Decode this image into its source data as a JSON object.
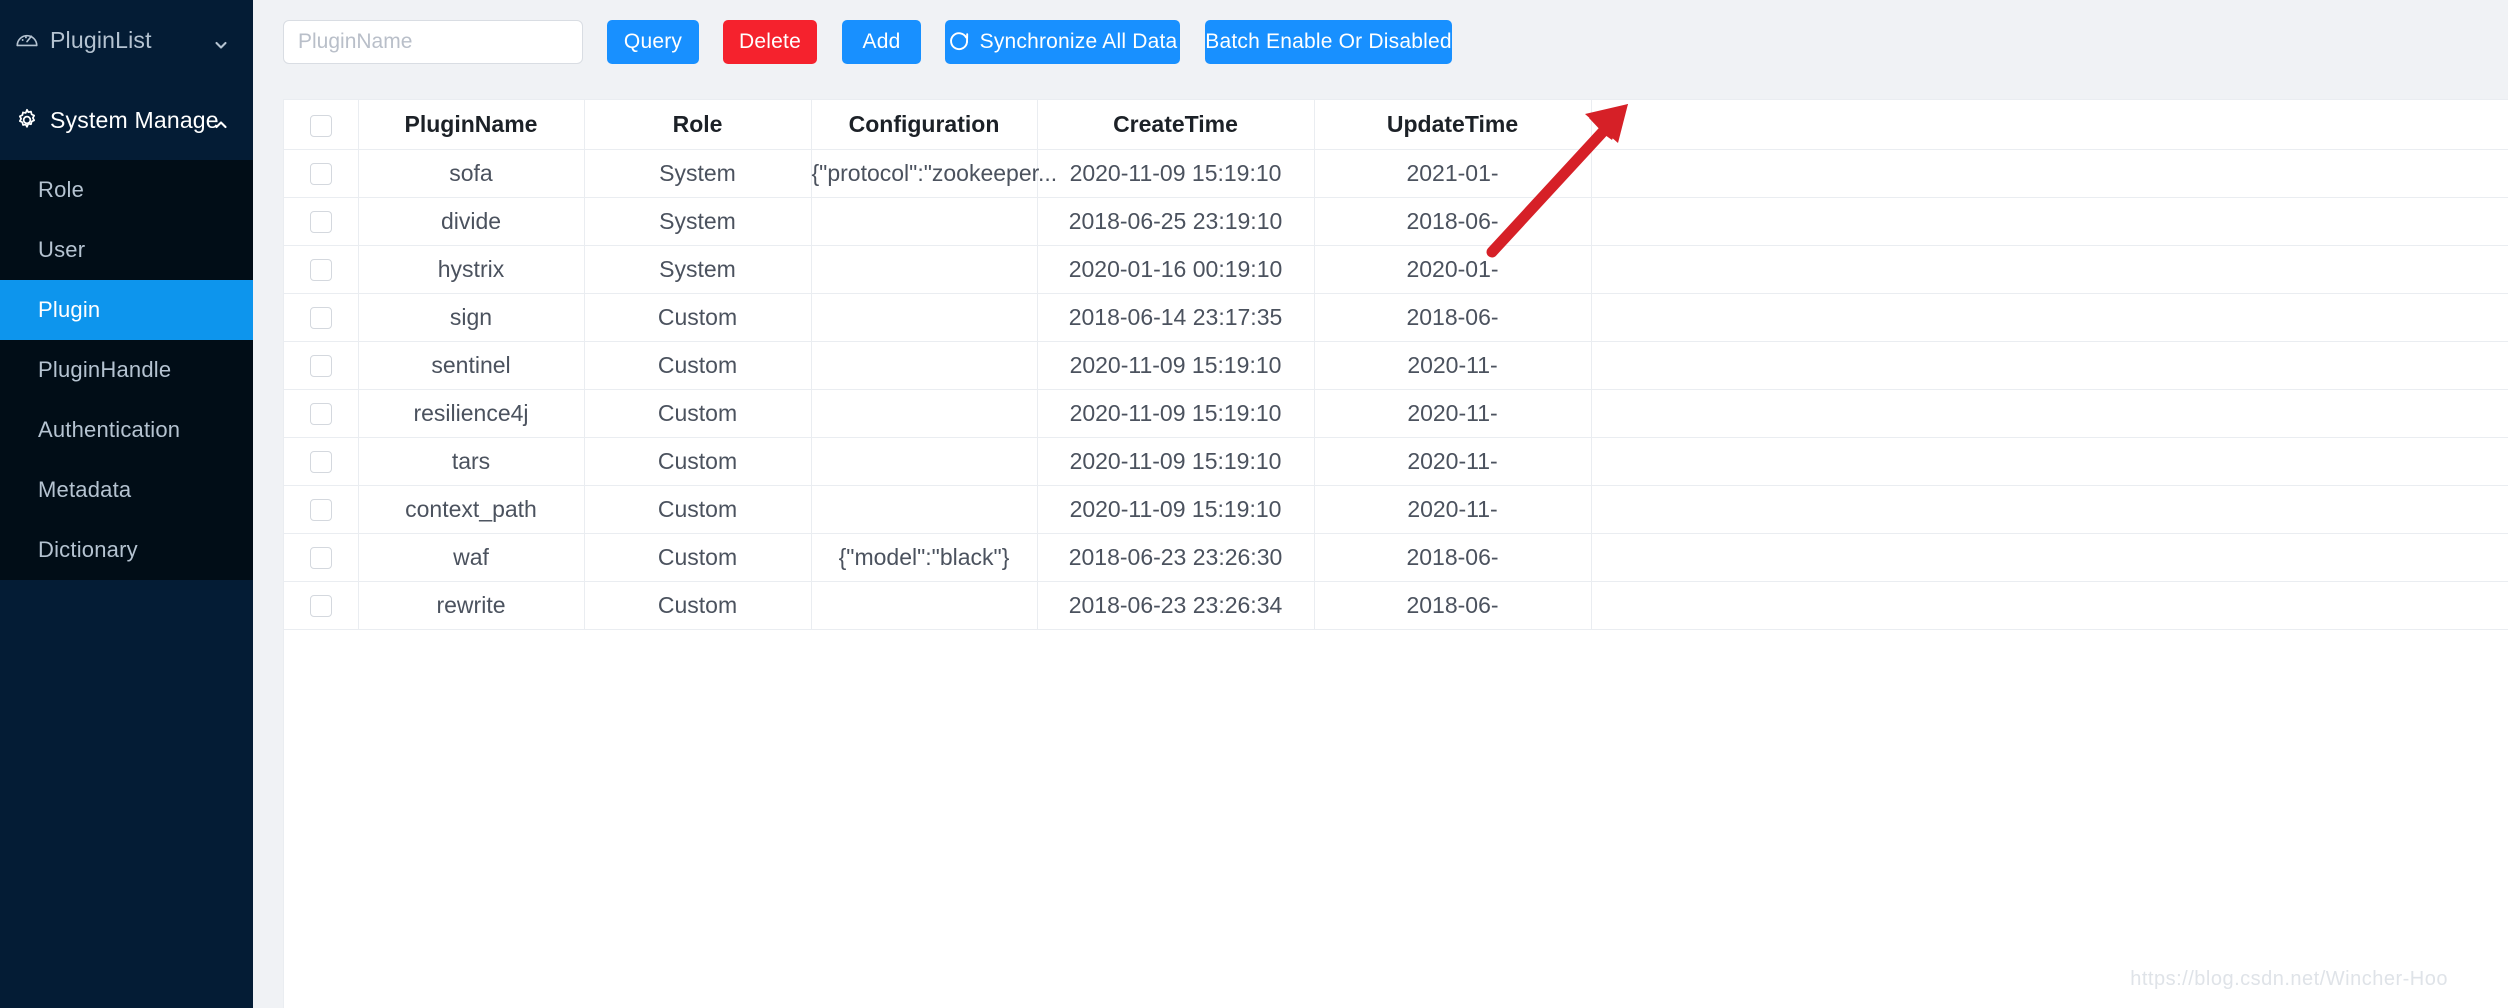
{
  "sidebar": {
    "top_items": [
      {
        "label": "PluginList",
        "icon": "dashboard-icon",
        "expanded": false,
        "chevron": "chevron-down-icon"
      },
      {
        "label": "System Manage",
        "icon": "gear-icon",
        "expanded": true,
        "chevron": "chevron-up-icon"
      }
    ],
    "submenu": [
      {
        "label": "Role",
        "selected": false
      },
      {
        "label": "User",
        "selected": false
      },
      {
        "label": "Plugin",
        "selected": true
      },
      {
        "label": "PluginHandle",
        "selected": false
      },
      {
        "label": "Authentication",
        "selected": false
      },
      {
        "label": "Metadata",
        "selected": false
      },
      {
        "label": "Dictionary",
        "selected": false
      }
    ],
    "colors": {
      "background": "#041c35",
      "submenu_background": "#010d17",
      "selected": "#0d95ed",
      "text": "#b5c3d1",
      "text_active": "#ffffff"
    }
  },
  "toolbar": {
    "search_placeholder": "PluginName",
    "search_value": "",
    "buttons": [
      {
        "label": "Query",
        "style": "primary",
        "color": "#1890ff"
      },
      {
        "label": "Delete",
        "style": "danger",
        "color": "#f5222d"
      },
      {
        "label": "Add",
        "style": "primary",
        "color": "#1890ff"
      },
      {
        "label": "Synchronize All Data",
        "style": "primary",
        "color": "#1890ff",
        "icon": "refresh-icon"
      },
      {
        "label": "Batch Enable Or Disabled",
        "style": "primary",
        "color": "#1890ff"
      }
    ]
  },
  "table": {
    "columns": [
      {
        "key": "checkbox",
        "label": ""
      },
      {
        "key": "name",
        "label": "PluginName"
      },
      {
        "key": "role",
        "label": "Role"
      },
      {
        "key": "configuration",
        "label": "Configuration"
      },
      {
        "key": "create_time",
        "label": "CreateTime"
      },
      {
        "key": "update_time",
        "label": "UpdateTime"
      }
    ],
    "rows": [
      {
        "name": "sofa",
        "role": "System",
        "configuration": "{\"protocol\":\"zookeeper...",
        "create_time": "2020-11-09 15:19:10",
        "update_time": "2021-01-"
      },
      {
        "name": "divide",
        "role": "System",
        "configuration": "",
        "create_time": "2018-06-25 23:19:10",
        "update_time": "2018-06-"
      },
      {
        "name": "hystrix",
        "role": "System",
        "configuration": "",
        "create_time": "2020-01-16 00:19:10",
        "update_time": "2020-01-"
      },
      {
        "name": "sign",
        "role": "Custom",
        "configuration": "",
        "create_time": "2018-06-14 23:17:35",
        "update_time": "2018-06-"
      },
      {
        "name": "sentinel",
        "role": "Custom",
        "configuration": "",
        "create_time": "2020-11-09 15:19:10",
        "update_time": "2020-11-"
      },
      {
        "name": "resilience4j",
        "role": "Custom",
        "configuration": "",
        "create_time": "2020-11-09 15:19:10",
        "update_time": "2020-11-"
      },
      {
        "name": "tars",
        "role": "Custom",
        "configuration": "",
        "create_time": "2020-11-09 15:19:10",
        "update_time": "2020-11-"
      },
      {
        "name": "context_path",
        "role": "Custom",
        "configuration": "",
        "create_time": "2020-11-09 15:19:10",
        "update_time": "2020-11-"
      },
      {
        "name": "waf",
        "role": "Custom",
        "configuration": "{\"model\":\"black\"}",
        "create_time": "2018-06-23 23:26:30",
        "update_time": "2018-06-"
      },
      {
        "name": "rewrite",
        "role": "Custom",
        "configuration": "",
        "create_time": "2018-06-23 23:26:34",
        "update_time": "2018-06-"
      }
    ]
  },
  "annotation": {
    "arrow_color": "#d62027",
    "arrow_from": "1492,252",
    "arrow_to": "1626,108"
  },
  "watermark": {
    "text": "https://blog.csdn.net/Wincher-Hoo"
  }
}
